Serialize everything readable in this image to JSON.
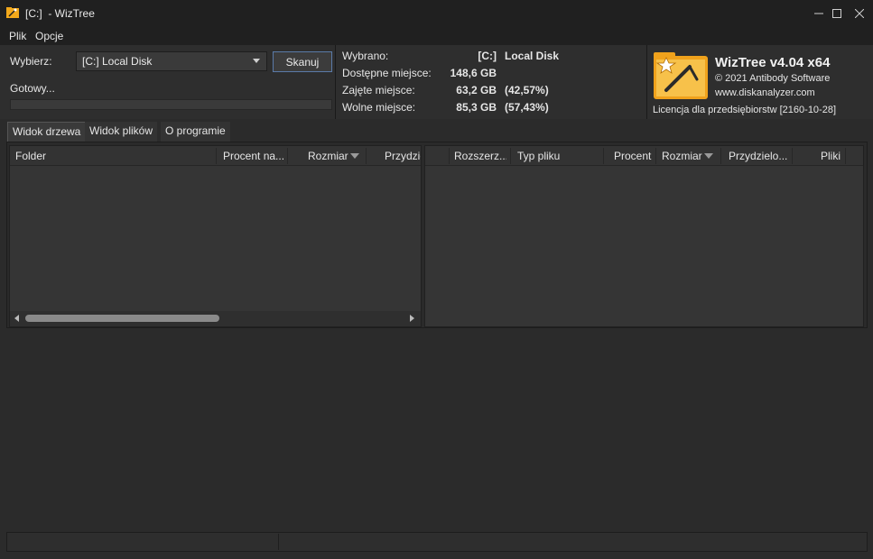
{
  "window": {
    "title": "[C:]  - WizTree"
  },
  "menu": [
    "Plik",
    "Opcje"
  ],
  "scan_panel": {
    "select_label": "Wybierz:",
    "selected_drive": "[C:] Local Disk",
    "scan_button": "Skanuj",
    "status": "Gotowy...",
    "progress": 0
  },
  "drive_info": {
    "selected_label": "Wybrano:",
    "selected_drive": "[C:]",
    "selected_name": "Local Disk",
    "capacity_label": "Dostępne miejsce:",
    "capacity_value": "148,6 GB",
    "used_label": "Zajęte miejsce:",
    "used_value": "63,2 GB",
    "used_percent": "(42,57%)",
    "free_label": "Wolne miejsce:",
    "free_value": "85,3 GB",
    "free_percent": "(57,43%)"
  },
  "about_panel": {
    "product": "WizTree v4.04 x64",
    "copyright": "© 2021 Antibody Software",
    "website": "www.diskanalyzer.com",
    "license": "Licencja dla przedsiębiorstw [2160-10-28]"
  },
  "tabs": [
    "Widok drzewa",
    "Widok plików",
    "O programie"
  ],
  "tree_columns": [
    "Folder",
    "Procent na...",
    "Rozmiar",
    "Przydzie"
  ],
  "ext_columns": [
    "Rozszerz...",
    "Typ pliku",
    "Procent",
    "Rozmiar",
    "Przydzielo...",
    "Pliki"
  ],
  "colors": {
    "background": "#2b2b2b",
    "titlebar": "#202020",
    "accent_border": "#5a7aa8"
  }
}
